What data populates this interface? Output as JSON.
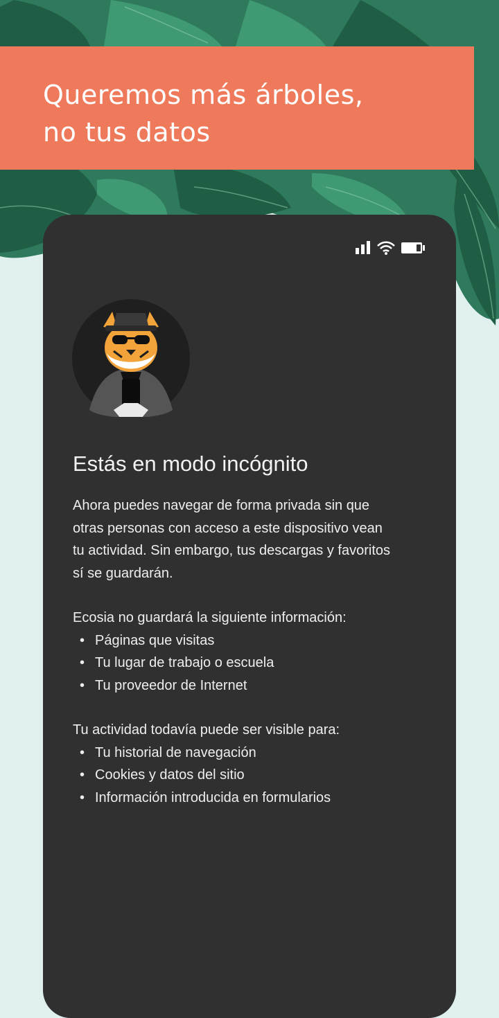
{
  "banner": {
    "headline_line1": "Queremos más árboles,",
    "headline_line2": "no tus datos",
    "background_color": "#ef7a5b"
  },
  "phone": {
    "status_icons": [
      "signal-icon",
      "wifi-icon",
      "battery-icon"
    ],
    "avatar": "incognito-tiger-icon",
    "title": "Estás en modo incógnito",
    "intro_lines": [
      "Ahora puedes navegar de forma privada sin que",
      "otras personas con acceso a este dispositivo vean",
      "tu actividad. Sin embargo, tus descargas y favoritos",
      "sí se guardarán."
    ],
    "not_saved_heading": "Ecosia no guardará la siguiente información:",
    "not_saved_items": [
      "Páginas que visitas",
      "Tu lugar de trabajo o escuela",
      "Tu proveedor de Internet"
    ],
    "visible_heading": "Tu actividad todavía puede ser visible para:",
    "visible_items": [
      "Tu historial de navegación",
      "Cookies y datos del sitio",
      "Información introducida en formularios"
    ],
    "bullet": "•",
    "background_color": "#303030"
  }
}
